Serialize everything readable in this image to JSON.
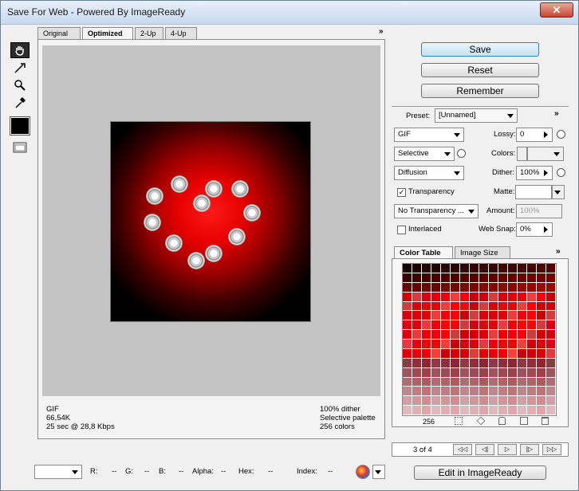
{
  "window": {
    "title": "Save For Web - Powered By ImageReady",
    "close_label": "✕"
  },
  "tabs": [
    {
      "label": "Original"
    },
    {
      "label": "Optimized"
    },
    {
      "label": "2-Up"
    },
    {
      "label": "4-Up"
    }
  ],
  "info": {
    "format": "GIF",
    "size": "66,54K",
    "time": "25 sec @ 28,8 Kbps",
    "dither": "100% dither",
    "palette": "Selective palette",
    "colors": "256 colors"
  },
  "buttons": {
    "save": "Save",
    "reset": "Reset",
    "remember": "Remember",
    "edit": "Edit in ImageReady"
  },
  "settings": {
    "preset_label": "Preset:",
    "preset_value": "[Unnamed]",
    "format": "GIF",
    "lossy_label": "Lossy:",
    "lossy_value": "0",
    "reduction": "Selective",
    "colors_label": "Colors:",
    "colors_value": "",
    "dither_algo": "Diffusion",
    "dither_label": "Dither:",
    "dither_value": "100%",
    "transparency_label": "Transparency",
    "transparency_checked": true,
    "matte_label": "Matte:",
    "transparency_dither": "No Transparency ...",
    "amount_label": "Amount:",
    "amount_value": "100%",
    "interlaced_label": "Interlaced",
    "websnap_label": "Web Snap:",
    "websnap_value": "0%"
  },
  "color_tabs": [
    {
      "label": "Color Table"
    },
    {
      "label": "Image Size"
    }
  ],
  "color_count": "256",
  "animation": {
    "frame": "3 of 4"
  },
  "bottom": {
    "r_label": "R:",
    "r_value": "--",
    "g_label": "G:",
    "g_value": "--",
    "b_label": "B:",
    "b_value": "--",
    "alpha_label": "Alpha:",
    "alpha_value": "--",
    "hex_label": "Hex:",
    "hex_value": "--",
    "index_label": "Index:",
    "index_value": "--"
  },
  "colors": {
    "accent": "#3c7fb1",
    "active_tool": "#2b2b2b"
  }
}
